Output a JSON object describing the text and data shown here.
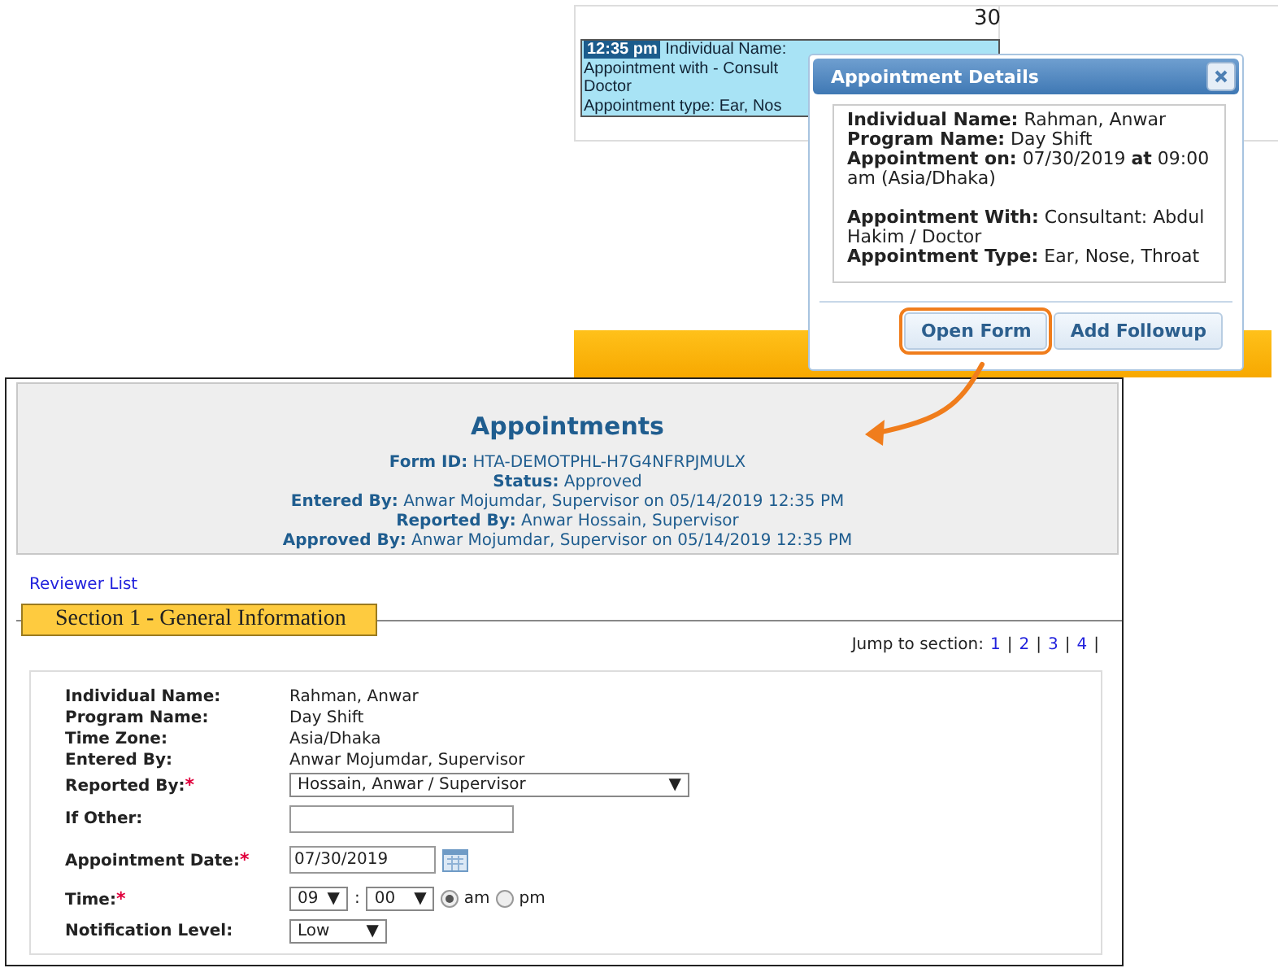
{
  "calendar": {
    "day_number": "30",
    "event": {
      "time": "12:35 pm",
      "lines": [
        "Individual Name:",
        "Appointment with - Consult",
        "Doctor",
        "Appointment type: Ear, Nos"
      ]
    }
  },
  "popup": {
    "title": "Appointment Details",
    "details": [
      {
        "label": "Individual Name:",
        "value": "Rahman, Anwar",
        "gap_before": false
      },
      {
        "label": "Program Name:",
        "value": "Day Shift",
        "gap_before": false
      },
      {
        "label": "Appointment on:",
        "value": "07/30/2019 **at** 09:00 am (Asia/Dhaka)",
        "gap_before": false
      },
      {
        "label": "Appointment With:",
        "value": "Consultant: Abdul Hakim / Doctor",
        "gap_before": true
      },
      {
        "label": "Appointment Type:",
        "value": "Ear, Nose, Throat",
        "gap_before": false
      }
    ],
    "buttons": [
      {
        "label": "Open Form",
        "highlighted": true
      },
      {
        "label": "Add Followup",
        "highlighted": false
      }
    ]
  },
  "form": {
    "title": "Appointments",
    "meta": [
      {
        "label": "Form ID:",
        "value": "HTA-DEMOTPHL-H7G4NFRPJMULX"
      },
      {
        "label": "Status:",
        "value": "Approved"
      },
      {
        "label": "Entered By:",
        "value": "Anwar Mojumdar, Supervisor  on 05/14/2019 12:35 PM"
      },
      {
        "label": "Reported By:",
        "value": "Anwar Hossain, Supervisor"
      },
      {
        "label": "Approved By:",
        "value": "Anwar Mojumdar, Supervisor  on 05/14/2019 12:35 PM"
      }
    ],
    "reviewer_link": "Reviewer List",
    "section_title": "Section 1 - General Information",
    "jump": {
      "label": "Jump to section:",
      "separator": "|",
      "links": [
        "1",
        "2",
        "3",
        "4"
      ]
    },
    "fields": [
      {
        "kind": "text",
        "label": "Individual Name:",
        "value": "Rahman, Anwar"
      },
      {
        "kind": "text",
        "label": "Program Name:",
        "value": "Day Shift"
      },
      {
        "kind": "text",
        "label": "Time Zone:",
        "value": "Asia/Dhaka"
      },
      {
        "kind": "text",
        "label": "Entered By:",
        "value": "Anwar Mojumdar, Supervisor"
      },
      {
        "kind": "select",
        "label": "Reported By:",
        "mark": "*",
        "value": "Hossain, Anwar / Supervisor",
        "arrow": "▼"
      },
      {
        "kind": "input",
        "label": "If Other:"
      },
      {
        "kind": "date",
        "label": "Appointment Date:",
        "mark": "*",
        "value": "07/30/2019"
      },
      {
        "kind": "time",
        "label": "Time:",
        "mark": "*",
        "hour": "09",
        "minute": "00",
        "arrow": "▼",
        "separator": ":",
        "periods": [
          {
            "label": "am",
            "selected": true
          },
          {
            "label": "pm",
            "selected": false
          }
        ]
      },
      {
        "kind": "select_small",
        "label": "Notification Level:",
        "value": "Low",
        "arrow": "▼"
      }
    ]
  }
}
